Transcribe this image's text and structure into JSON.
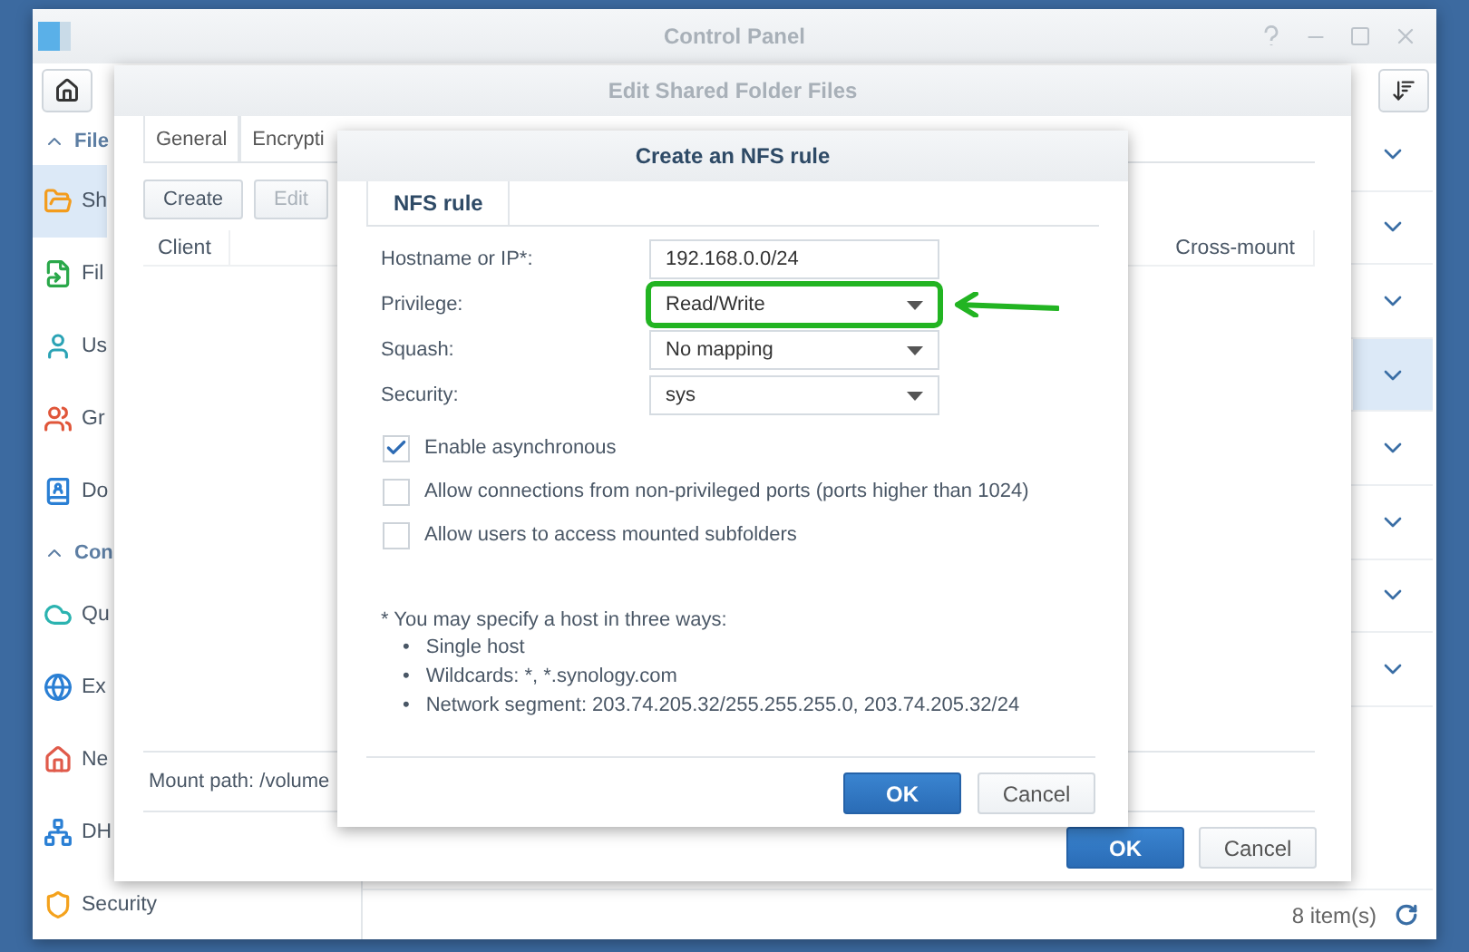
{
  "control_panel": {
    "title": "Control Panel",
    "sidebar": [
      {
        "label": "File",
        "expanded": true,
        "items": [
          {
            "label": "Sh",
            "kind": "folder",
            "selected": true
          },
          {
            "label": "Fil",
            "kind": "file",
            "selected": false
          },
          {
            "label": "Us",
            "kind": "user",
            "selected": false
          },
          {
            "label": "Gr",
            "kind": "group",
            "selected": false
          },
          {
            "label": "Do",
            "kind": "directory",
            "selected": false
          }
        ]
      },
      {
        "label": "Con",
        "expanded": true,
        "items": [
          {
            "label": "Qu",
            "kind": "cloud",
            "selected": false
          },
          {
            "label": "Ex",
            "kind": "globe",
            "selected": false
          },
          {
            "label": "Ne",
            "kind": "house",
            "selected": false
          },
          {
            "label": "DH",
            "kind": "network",
            "selected": false
          },
          {
            "label": "Security",
            "kind": "shield",
            "selected": false
          }
        ]
      }
    ],
    "rows": [
      {
        "selected": false
      },
      {
        "selected": false
      },
      {
        "selected": false
      },
      {
        "selected": true
      },
      {
        "selected": false
      },
      {
        "selected": false
      },
      {
        "selected": false
      },
      {
        "selected": false
      }
    ],
    "status": "8 item(s)"
  },
  "edit_window": {
    "title": "Edit Shared Folder Files",
    "tabs": [
      {
        "label": "General",
        "selected": false
      },
      {
        "label": "Encrypti",
        "selected": false
      }
    ],
    "toolbar": [
      {
        "label": "Create",
        "disabled": false
      },
      {
        "label": "Edit",
        "disabled": true
      }
    ],
    "columns": [
      "Client",
      "Cross-mount"
    ],
    "mount_path": "Mount path: /volume",
    "buttons": [
      {
        "label": "OK",
        "kind": "primary"
      },
      {
        "label": "Cancel",
        "kind": "secondary"
      }
    ]
  },
  "dialog": {
    "title": "Create an NFS rule",
    "tabs": [
      {
        "label": "NFS rule",
        "selected": true
      }
    ],
    "fields": [
      {
        "label": "Hostname or IP*:",
        "kind": "text",
        "value": "192.168.0.0/24",
        "highlighted": false
      },
      {
        "label": "Privilege:",
        "kind": "select",
        "value": "Read/Write",
        "highlighted": true
      },
      {
        "label": "Squash:",
        "kind": "select",
        "value": "No mapping",
        "highlighted": false
      },
      {
        "label": "Security:",
        "kind": "select",
        "value": "sys",
        "highlighted": false
      }
    ],
    "checkboxes": [
      {
        "label": "Enable asynchronous",
        "checked": true
      },
      {
        "label": "Allow connections from non-privileged ports (ports higher than 1024)",
        "checked": false
      },
      {
        "label": "Allow users to access mounted subfolders",
        "checked": false
      }
    ],
    "note": "* You may specify a host in three ways:",
    "bullets": [
      {
        "marker": "•",
        "text": "Single host"
      },
      {
        "marker": "•",
        "text": "Wildcards: *, *.synology.com"
      },
      {
        "marker": "•",
        "text": "Network segment: 203.74.205.32/255.255.255.0, 203.74.205.32/24"
      }
    ],
    "buttons": [
      {
        "label": "OK",
        "kind": "primary"
      },
      {
        "label": "Cancel",
        "kind": "secondary"
      }
    ]
  }
}
